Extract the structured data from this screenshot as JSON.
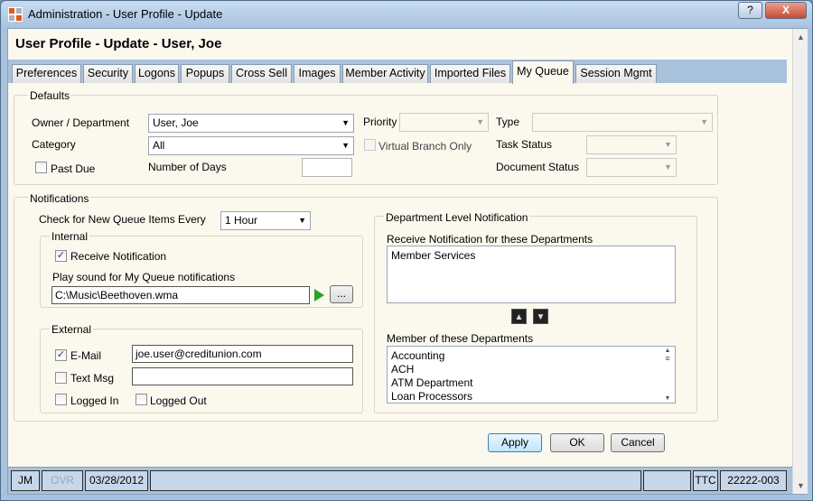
{
  "window": {
    "title": "Administration - User Profile - Update",
    "help_label": "?",
    "close_label": "X"
  },
  "page_title": "User Profile - Update - User, Joe",
  "tabs": [
    {
      "label": "Preferences"
    },
    {
      "label": "Security"
    },
    {
      "label": "Logons"
    },
    {
      "label": "Popups"
    },
    {
      "label": "Cross Sell"
    },
    {
      "label": "Images"
    },
    {
      "label": "Member Activity"
    },
    {
      "label": "Imported Files"
    },
    {
      "label": "My Queue"
    },
    {
      "label": "Session Mgmt"
    }
  ],
  "defaults": {
    "group_label": "Defaults",
    "owner_label": "Owner / Department",
    "owner_value": "User, Joe",
    "category_label": "Category",
    "category_value": "All",
    "past_due_label": "Past Due",
    "number_of_days_label": "Number of Days",
    "number_of_days_value": "",
    "priority_label": "Priority",
    "priority_value": "",
    "virtual_branch_label": "Virtual Branch Only",
    "type_label": "Type",
    "type_value": "",
    "task_status_label": "Task Status",
    "task_status_value": "",
    "document_status_label": "Document Status",
    "document_status_value": ""
  },
  "notifications": {
    "group_label": "Notifications",
    "check_every_label": "Check for New Queue Items Every",
    "check_every_value": "1 Hour",
    "internal": {
      "group_label": "Internal",
      "receive_label": "Receive Notification",
      "receive_checked": true,
      "sound_label": "Play sound for My Queue notifications",
      "sound_path": "C:\\Music\\Beethoven.wma",
      "browse_label": "..."
    },
    "external": {
      "group_label": "External",
      "email_label": "E-Mail",
      "email_checked": true,
      "email_value": "joe.user@creditunion.com",
      "text_label": "Text Msg",
      "text_value": "",
      "logged_in_label": "Logged In",
      "logged_out_label": "Logged Out"
    },
    "department": {
      "group_label": "Department Level Notification",
      "receive_label": "Receive Notification for these Departments",
      "receive_items": [
        "Member Services"
      ],
      "member_label": "Member of these Departments",
      "member_items": [
        "Accounting",
        "ACH",
        "ATM Department",
        "Loan Processors"
      ]
    }
  },
  "buttons": {
    "apply": "Apply",
    "ok": "OK",
    "cancel": "Cancel"
  },
  "statusbar": {
    "user": "JM",
    "ovr": "OVR",
    "date": "03/28/2012",
    "ttc": "TTC",
    "code": "22222-003"
  },
  "colors": {
    "chrome_blue": "#a9c2dc",
    "panel_bg": "#fbf8ee",
    "play_green": "#2aa22a"
  }
}
